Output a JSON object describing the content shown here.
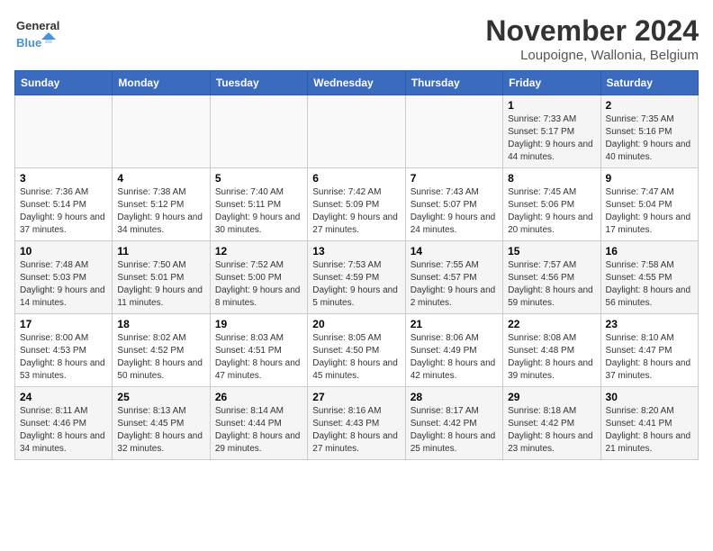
{
  "header": {
    "logo_general": "General",
    "logo_blue": "Blue",
    "month_title": "November 2024",
    "subtitle": "Loupoigne, Wallonia, Belgium"
  },
  "weekdays": [
    "Sunday",
    "Monday",
    "Tuesday",
    "Wednesday",
    "Thursday",
    "Friday",
    "Saturday"
  ],
  "rows": [
    [
      {
        "day": "",
        "info": ""
      },
      {
        "day": "",
        "info": ""
      },
      {
        "day": "",
        "info": ""
      },
      {
        "day": "",
        "info": ""
      },
      {
        "day": "",
        "info": ""
      },
      {
        "day": "1",
        "info": "Sunrise: 7:33 AM\nSunset: 5:17 PM\nDaylight: 9 hours\nand 44 minutes."
      },
      {
        "day": "2",
        "info": "Sunrise: 7:35 AM\nSunset: 5:16 PM\nDaylight: 9 hours\nand 40 minutes."
      }
    ],
    [
      {
        "day": "3",
        "info": "Sunrise: 7:36 AM\nSunset: 5:14 PM\nDaylight: 9 hours\nand 37 minutes."
      },
      {
        "day": "4",
        "info": "Sunrise: 7:38 AM\nSunset: 5:12 PM\nDaylight: 9 hours\nand 34 minutes."
      },
      {
        "day": "5",
        "info": "Sunrise: 7:40 AM\nSunset: 5:11 PM\nDaylight: 9 hours\nand 30 minutes."
      },
      {
        "day": "6",
        "info": "Sunrise: 7:42 AM\nSunset: 5:09 PM\nDaylight: 9 hours\nand 27 minutes."
      },
      {
        "day": "7",
        "info": "Sunrise: 7:43 AM\nSunset: 5:07 PM\nDaylight: 9 hours\nand 24 minutes."
      },
      {
        "day": "8",
        "info": "Sunrise: 7:45 AM\nSunset: 5:06 PM\nDaylight: 9 hours\nand 20 minutes."
      },
      {
        "day": "9",
        "info": "Sunrise: 7:47 AM\nSunset: 5:04 PM\nDaylight: 9 hours\nand 17 minutes."
      }
    ],
    [
      {
        "day": "10",
        "info": "Sunrise: 7:48 AM\nSunset: 5:03 PM\nDaylight: 9 hours\nand 14 minutes."
      },
      {
        "day": "11",
        "info": "Sunrise: 7:50 AM\nSunset: 5:01 PM\nDaylight: 9 hours\nand 11 minutes."
      },
      {
        "day": "12",
        "info": "Sunrise: 7:52 AM\nSunset: 5:00 PM\nDaylight: 9 hours\nand 8 minutes."
      },
      {
        "day": "13",
        "info": "Sunrise: 7:53 AM\nSunset: 4:59 PM\nDaylight: 9 hours\nand 5 minutes."
      },
      {
        "day": "14",
        "info": "Sunrise: 7:55 AM\nSunset: 4:57 PM\nDaylight: 9 hours\nand 2 minutes."
      },
      {
        "day": "15",
        "info": "Sunrise: 7:57 AM\nSunset: 4:56 PM\nDaylight: 8 hours\nand 59 minutes."
      },
      {
        "day": "16",
        "info": "Sunrise: 7:58 AM\nSunset: 4:55 PM\nDaylight: 8 hours\nand 56 minutes."
      }
    ],
    [
      {
        "day": "17",
        "info": "Sunrise: 8:00 AM\nSunset: 4:53 PM\nDaylight: 8 hours\nand 53 minutes."
      },
      {
        "day": "18",
        "info": "Sunrise: 8:02 AM\nSunset: 4:52 PM\nDaylight: 8 hours\nand 50 minutes."
      },
      {
        "day": "19",
        "info": "Sunrise: 8:03 AM\nSunset: 4:51 PM\nDaylight: 8 hours\nand 47 minutes."
      },
      {
        "day": "20",
        "info": "Sunrise: 8:05 AM\nSunset: 4:50 PM\nDaylight: 8 hours\nand 45 minutes."
      },
      {
        "day": "21",
        "info": "Sunrise: 8:06 AM\nSunset: 4:49 PM\nDaylight: 8 hours\nand 42 minutes."
      },
      {
        "day": "22",
        "info": "Sunrise: 8:08 AM\nSunset: 4:48 PM\nDaylight: 8 hours\nand 39 minutes."
      },
      {
        "day": "23",
        "info": "Sunrise: 8:10 AM\nSunset: 4:47 PM\nDaylight: 8 hours\nand 37 minutes."
      }
    ],
    [
      {
        "day": "24",
        "info": "Sunrise: 8:11 AM\nSunset: 4:46 PM\nDaylight: 8 hours\nand 34 minutes."
      },
      {
        "day": "25",
        "info": "Sunrise: 8:13 AM\nSunset: 4:45 PM\nDaylight: 8 hours\nand 32 minutes."
      },
      {
        "day": "26",
        "info": "Sunrise: 8:14 AM\nSunset: 4:44 PM\nDaylight: 8 hours\nand 29 minutes."
      },
      {
        "day": "27",
        "info": "Sunrise: 8:16 AM\nSunset: 4:43 PM\nDaylight: 8 hours\nand 27 minutes."
      },
      {
        "day": "28",
        "info": "Sunrise: 8:17 AM\nSunset: 4:42 PM\nDaylight: 8 hours\nand 25 minutes."
      },
      {
        "day": "29",
        "info": "Sunrise: 8:18 AM\nSunset: 4:42 PM\nDaylight: 8 hours\nand 23 minutes."
      },
      {
        "day": "30",
        "info": "Sunrise: 8:20 AM\nSunset: 4:41 PM\nDaylight: 8 hours\nand 21 minutes."
      }
    ]
  ]
}
